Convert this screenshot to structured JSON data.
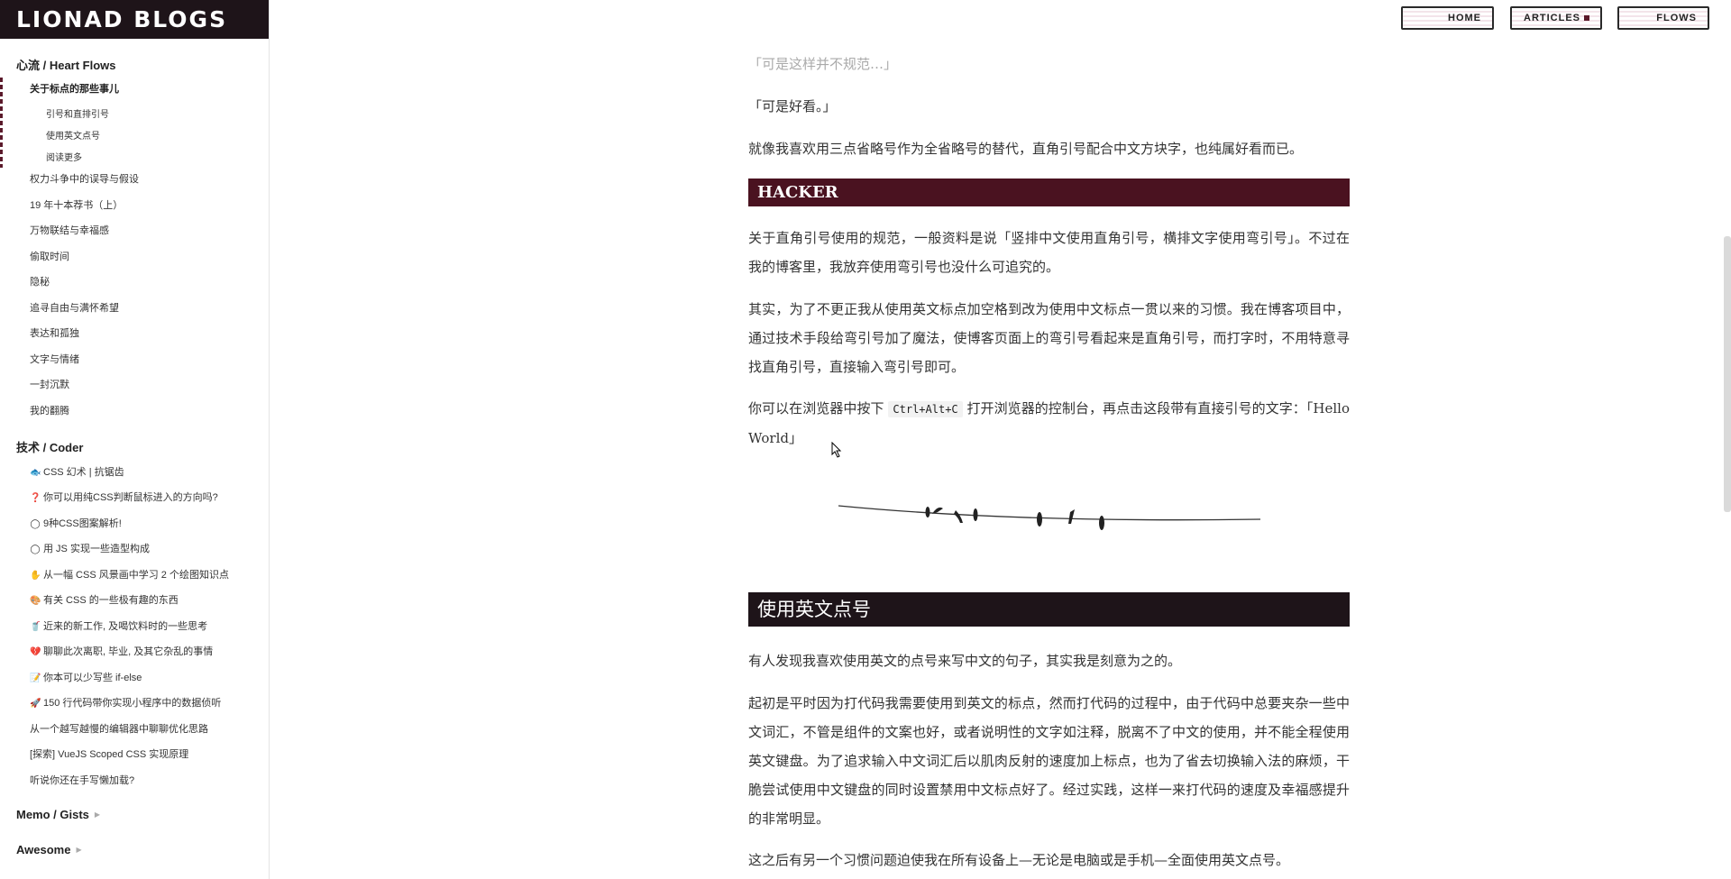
{
  "sidebar": {
    "logo": "LIONAD BLOGS",
    "sections": {
      "heart": "心流 / Heart Flows",
      "coder": "技术 / Coder",
      "memo": "Memo / Gists",
      "awesome": "Awesome"
    },
    "heart_items": [
      "关于标点的那些事儿",
      "权力斗争中的误导与假设",
      "19 年十本荐书（上）",
      "万物联结与幸福感",
      "偷取时间",
      "隐秘",
      "追寻自由与满怀希望",
      "表达和孤独",
      "文字与情绪",
      "一封沉默",
      "我的翻腾"
    ],
    "sub_items": [
      "引号和直排引号",
      "使用英文点号",
      "阅读更多"
    ],
    "coder_items": [
      {
        "icon": "🐟",
        "label": "CSS 幻术 | 抗锯齿"
      },
      {
        "icon": "❓",
        "label": "你可以用纯CSS判断鼠标进入的方向吗?"
      },
      {
        "icon": "◯",
        "label": "9种CSS图案解析!"
      },
      {
        "icon": "◯",
        "label": "用 JS 实现一些造型构成"
      },
      {
        "icon": "✋",
        "label": "从一幅 CSS 风景画中学习 2 个绘图知识点"
      },
      {
        "icon": "🎨",
        "label": "有关 CSS 的一些极有趣的东西"
      },
      {
        "icon": "🥤",
        "label": "近来的新工作, 及喝饮料时的一些思考"
      },
      {
        "icon": "💔",
        "label": "聊聊此次离职, 毕业, 及其它杂乱的事情"
      },
      {
        "icon": "📝",
        "label": "你本可以少写些 if-else"
      },
      {
        "icon": "🚀",
        "label": "150 行代码带你实现小程序中的数据侦听"
      },
      {
        "icon": "",
        "label": "从一个越写越慢的编辑器中聊聊优化思路"
      },
      {
        "icon": "",
        "label": "[探索] VueJS Scoped CSS 实现原理"
      },
      {
        "icon": "",
        "label": "听说你还在手写懒加载?"
      }
    ]
  },
  "topnav": {
    "home": "HOME",
    "articles": "ARTICLES",
    "flows": "FLOWS"
  },
  "article": {
    "p_muted": "「可是这样并不规范…」",
    "p1": "「可是好看。」",
    "p2": "就像我喜欢用三点省略号作为全省略号的替代，直角引号配合中文方块字，也纯属好看而已。",
    "h_hacker": "HACKER",
    "p3": "关于直角引号使用的规范，一般资料是说「竖排中文使用直角引号，横排文字使用弯引号」。不过在我的博客里，我放弃使用弯引号也没什么可追究的。",
    "p4": "其实，为了不更正我从使用英文标点加空格到改为使用中文标点一贯以来的习惯。我在博客项目中，通过技术手段给弯引号加了魔法，使博客页面上的弯引号看起来是直角引号，而打字时，不用特意寻找直角引号，直接输入弯引号即可。",
    "p5_a": "你可以在浏览器中按下",
    "p5_code": "Ctrl+Alt+C",
    "p5_b": "打开浏览器的控制台，再点击这段带有直接引号的文字：「Hello World」",
    "h_dot": "使用英文点号",
    "p6": "有人发现我喜欢使用英文的点号来写中文的句子，其实我是刻意为之的。",
    "p7": "起初是平时因为打代码我需要使用到英文的标点，然而打代码的过程中，由于代码中总要夹杂一些中文词汇，不管是组件的文案也好，或者说明性的文字如注释，脱离不了中文的使用，并不能全程使用英文键盘。为了追求输入中文词汇后以肌肉反射的速度加上标点，也为了省去切换输入法的麻烦，干脆尝试使用中文键盘的同时设置禁用中文标点好了。经过实践，这样一来打代码的速度及幸福感提升的非常明显。",
    "p8": "这之后有另一个习惯问题迫使我在所有设备上—无论是电脑或是手机—全面使用英文点号。"
  },
  "colors": {
    "logo_bg": "#1e1419",
    "hacker_bg": "#4a1220",
    "dot_heading_bg": "#1e1419",
    "accent": "#5b1a2b"
  }
}
